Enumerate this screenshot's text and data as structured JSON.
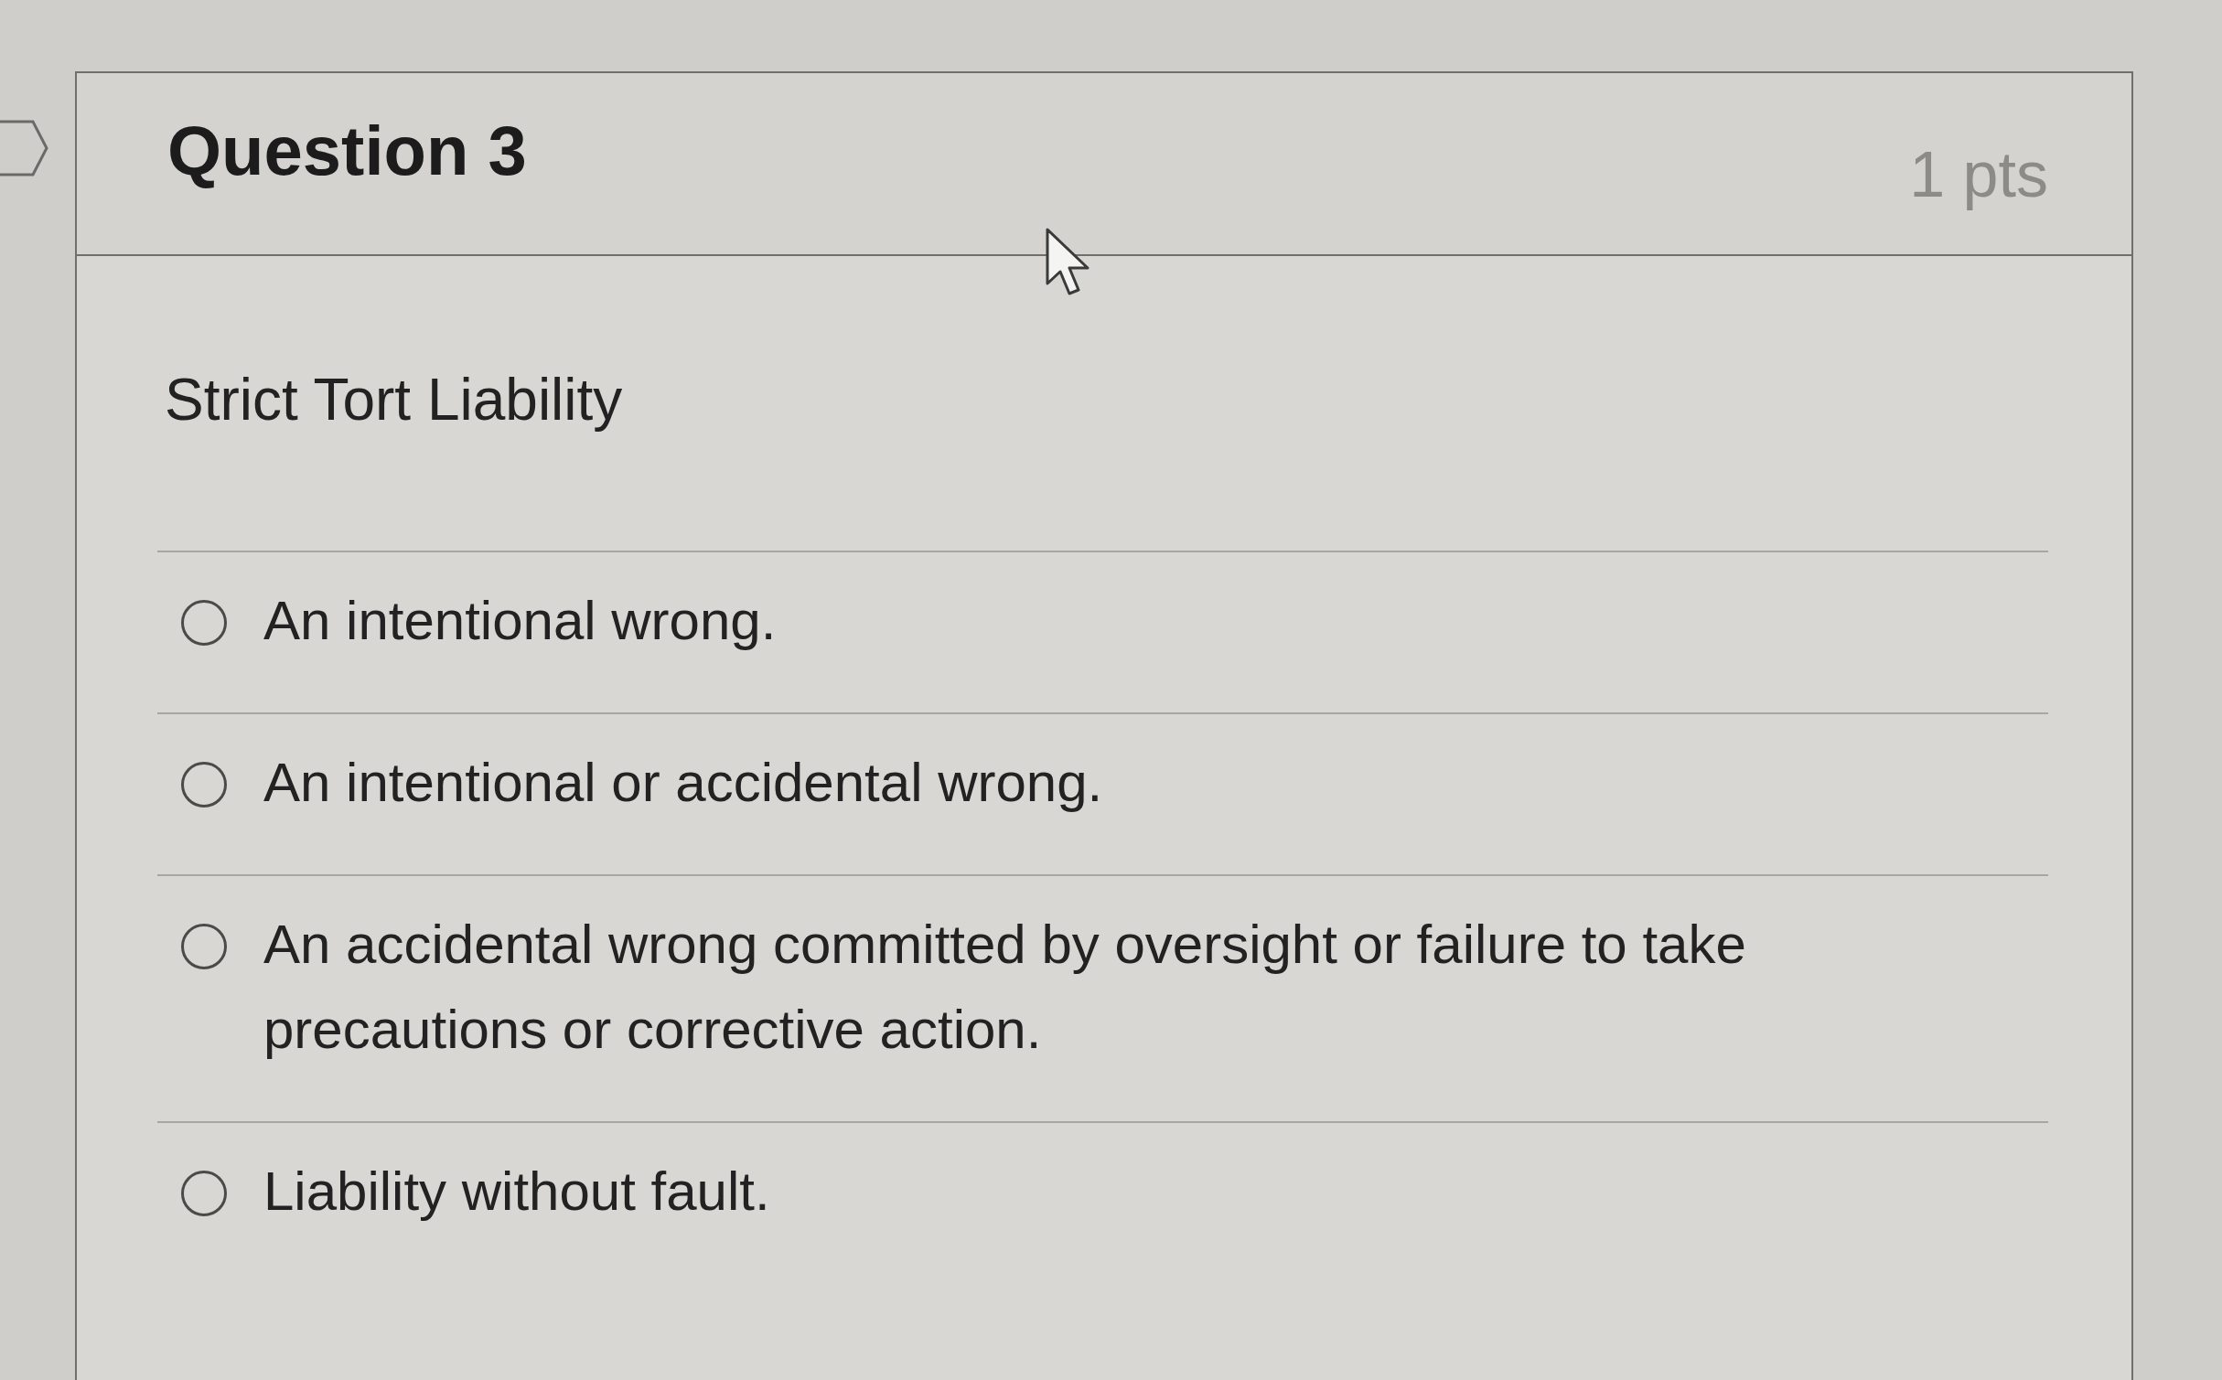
{
  "question": {
    "title": "Question 3",
    "points": "1 pts",
    "text": "Strict Tort Liability",
    "options": [
      {
        "label": "An intentional wrong.",
        "selected": false
      },
      {
        "label": "An intentional or accidental wrong.",
        "selected": false
      },
      {
        "label": "An accidental wrong committed by oversight or failure to take precautions or corrective action.",
        "selected": false
      },
      {
        "label": "Liability without fault.",
        "selected": false
      }
    ]
  }
}
